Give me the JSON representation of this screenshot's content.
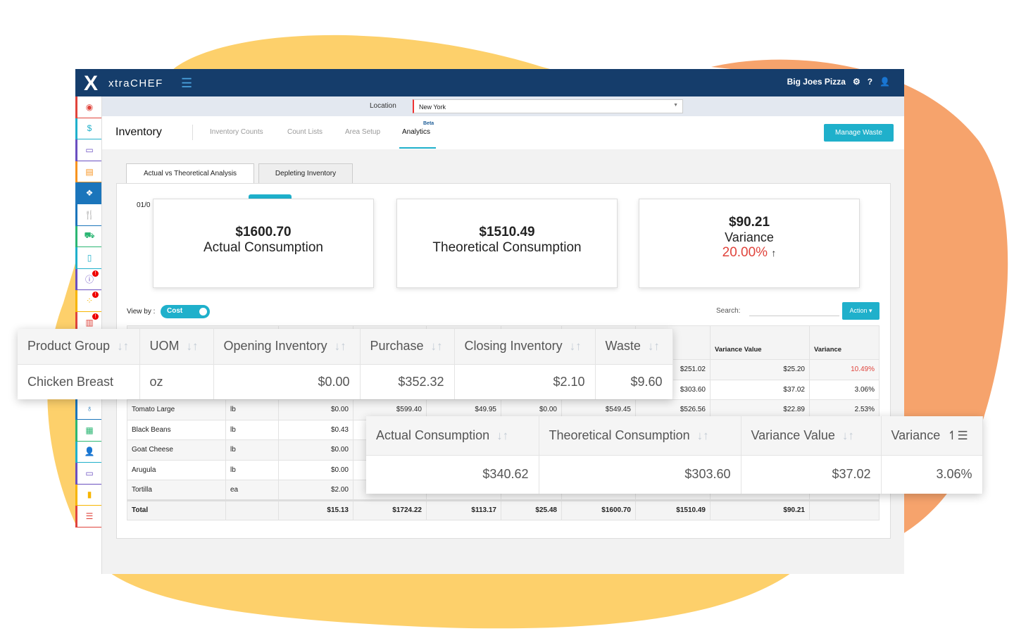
{
  "colors": {
    "header": "#153d6b",
    "accent": "#1fb0cb",
    "negative": "#e0443c",
    "blob_yellow": "#fdd06b",
    "blob_orange": "#f6a36c"
  },
  "header": {
    "logo": "X",
    "brand": "xtraCHEF",
    "menu_icon": "hamburger-icon",
    "account": "Big Joes Pizza",
    "icons": [
      "gear-icon",
      "help-icon",
      "user-icon"
    ]
  },
  "location": {
    "label": "Location",
    "value": "New York"
  },
  "nav": {
    "title": "Inventory",
    "items": [
      "Inventory Counts",
      "Count Lists",
      "Area Setup",
      "Analytics"
    ],
    "beta": "Beta",
    "active": "Analytics",
    "manage_waste": "Manage Waste"
  },
  "tabs": [
    "Actual vs Theoretical Analysis",
    "Depleting Inventory"
  ],
  "date_partial": "01/0",
  "cards": [
    {
      "value": "$1600.70",
      "label": "Actual Consumption"
    },
    {
      "value": "$1510.49",
      "label": "Theoretical Consumption"
    },
    {
      "value": "$90.21",
      "label": "Variance",
      "pct": "20.00%",
      "arrow": "↑"
    }
  ],
  "view_by": {
    "label": "View by :",
    "toggle": "Cost"
  },
  "search": {
    "label": "Search:",
    "value": ""
  },
  "action": "Action ▾",
  "table": {
    "headers": [
      "",
      "",
      "",
      "",
      "",
      "",
      "ical\ntion",
      "Variance Value",
      "Variance"
    ],
    "rows": [
      [
        "",
        "",
        "",
        "",
        "",
        "",
        "",
        "$251.02",
        "$25.20",
        "10.49%"
      ],
      [
        "",
        "",
        "",
        "",
        "",
        "",
        "",
        "$303.60",
        "$37.02",
        "3.06%"
      ],
      [
        "Tomato Large",
        "lb",
        "$0.00",
        "$599.40",
        "$49.95",
        "$0.00",
        "$549.45",
        "$526.56",
        "$22.89",
        "2.53%"
      ],
      [
        "Black Beans",
        "lb",
        "$0.43",
        "",
        "",
        "",
        "",
        "",
        "",
        ""
      ],
      [
        "Goat Cheese",
        "lb",
        "$0.00",
        "",
        "",
        "",
        "",
        "",
        "",
        ""
      ],
      [
        "Arugula",
        "lb",
        "$0.00",
        "",
        "",
        "",
        "",
        "",
        "",
        ""
      ],
      [
        "Tortilla",
        "ea",
        "$2.00",
        "",
        "",
        "",
        "",
        "",
        "",
        ""
      ]
    ],
    "total": [
      "Total",
      "",
      "$15.13",
      "$1724.22",
      "$113.17",
      "$25.48",
      "$1600.70",
      "$1510.49",
      "$90.21",
      ""
    ]
  },
  "overlay1": {
    "headers": [
      "Product Group",
      "UOM",
      "Opening Inventory",
      "Purchase",
      "Closing Inventory",
      "Waste"
    ],
    "row": [
      "Chicken Breast",
      "oz",
      "$0.00",
      "$352.32",
      "$2.10",
      "$9.60"
    ]
  },
  "overlay2": {
    "headers": [
      "Actual Consumption",
      "Theoretical Consumption",
      "Variance Value",
      "Variance"
    ],
    "row": [
      "$340.62",
      "$303.60",
      "$37.02",
      "3.06%"
    ]
  }
}
